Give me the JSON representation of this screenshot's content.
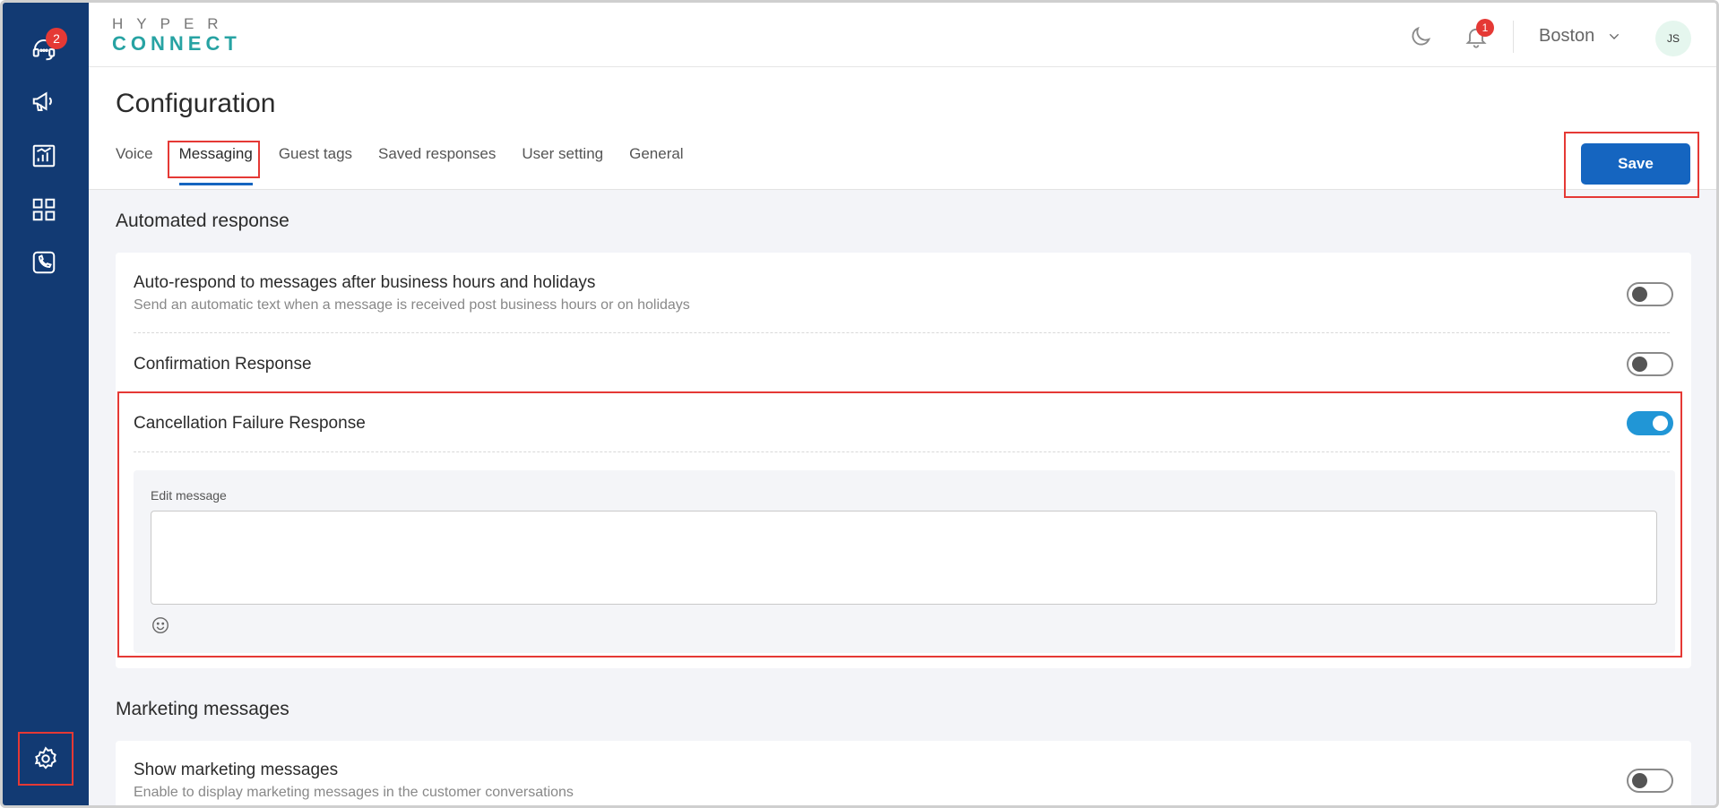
{
  "app": {
    "logo_top": "HYPER",
    "logo_bottom": "CONNECT"
  },
  "sidebar": {
    "items": [
      {
        "icon": "headset-icon",
        "badge": "2"
      },
      {
        "icon": "megaphone-icon"
      },
      {
        "icon": "report-icon"
      },
      {
        "icon": "dashboard-icon"
      },
      {
        "icon": "phone-icon"
      },
      {
        "icon": "gear-icon"
      }
    ]
  },
  "topbar": {
    "notification_count": "1",
    "location": "Boston",
    "avatar_initials": "JS"
  },
  "header": {
    "title": "Configuration",
    "tabs": [
      {
        "label": "Voice"
      },
      {
        "label": "Messaging",
        "active": true
      },
      {
        "label": "Guest tags"
      },
      {
        "label": "Saved responses"
      },
      {
        "label": "User setting"
      },
      {
        "label": "General"
      }
    ],
    "save_label": "Save"
  },
  "automated": {
    "section_title": "Automated response",
    "rows": [
      {
        "title": "Auto-respond to messages after business hours and holidays",
        "subtitle": "Send an automatic text when a message is received post business hours or on holidays",
        "enabled": false
      },
      {
        "title": "Confirmation Response",
        "enabled": false
      },
      {
        "title": "Cancellation Failure Response",
        "enabled": true
      }
    ],
    "edit_label": "Edit message",
    "edit_value": ""
  },
  "marketing": {
    "section_title": "Marketing messages",
    "row": {
      "title": "Show marketing messages",
      "subtitle": "Enable to display marketing messages in the customer conversations",
      "enabled": false
    }
  },
  "colors": {
    "sidebar": "#123a73",
    "accent": "#1565c0",
    "toggle_on": "#2196d6",
    "highlight": "#e53935",
    "logo": "#27a3a3"
  }
}
